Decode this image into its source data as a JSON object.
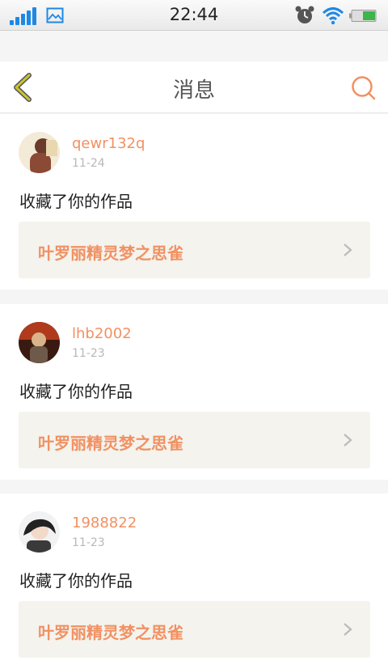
{
  "status_bar": {
    "time": "22:44",
    "signal_icon": "signal-bars-icon",
    "image_icon": "image-icon",
    "alarm_icon": "alarm-clock-icon",
    "wifi_icon": "wifi-icon",
    "battery_icon": "battery-icon",
    "colors": {
      "signal": "#1e88e5",
      "battery": "#3cb54a"
    }
  },
  "header": {
    "title": "消息",
    "back_icon": "back-chevron-icon",
    "search_icon": "search-icon",
    "colors": {
      "back": "#c8c23a",
      "search": "#f19162"
    }
  },
  "messages": [
    {
      "username": "qewr132q",
      "date": "11-24",
      "action": "收藏了你的作品",
      "work_title": "叶罗丽精灵梦之思雀"
    },
    {
      "username": "lhb2002",
      "date": "11-23",
      "action": "收藏了你的作品",
      "work_title": "叶罗丽精灵梦之思雀"
    },
    {
      "username": "1988822",
      "date": "11-23",
      "action": "收藏了你的作品",
      "work_title": "叶罗丽精灵梦之思雀"
    }
  ],
  "colors": {
    "accent": "#f19162",
    "background": "#f5f5f5",
    "work_card": "#f4f3ee"
  }
}
